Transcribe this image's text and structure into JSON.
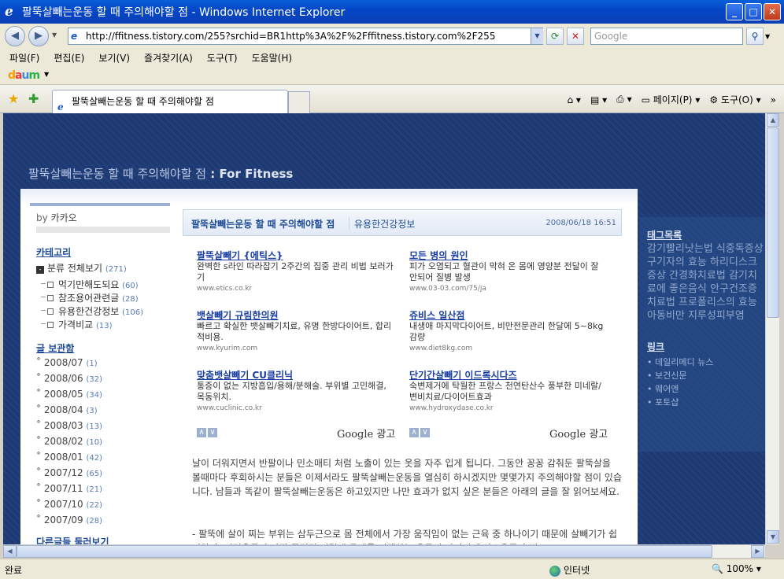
{
  "window": {
    "title": "팔뚝살빼는운동 할 때 주의해야할 점 - Windows Internet Explorer"
  },
  "address": {
    "url": "http://ffitness.tistory.com/255?srchid=BR1http%3A%2F%2Fffitness.tistory.com%2F255",
    "search_placeholder": "Google"
  },
  "menu": [
    "파일(F)",
    "편집(E)",
    "보기(V)",
    "즐겨찾기(A)",
    "도구(T)",
    "도움말(H)"
  ],
  "linkbar": {
    "logo": "daum"
  },
  "tab": {
    "title": "팔뚝살빼는운동 할 때 주의해야할 점"
  },
  "toolbar": {
    "page": "페이지(P)",
    "tools": "도구(O)"
  },
  "blog": {
    "title": "팔뚝살빼는운동 할 때 주의해야할 점",
    "suffix": " : For Fitness"
  },
  "left": {
    "by_prefix": "by ",
    "by_name": "카카오",
    "cat_heading": "카테고리",
    "cat_all": "분류 전체보기",
    "cat_all_count": "(271)",
    "cats": [
      {
        "label": "먹기만해도되요",
        "count": "(60)"
      },
      {
        "label": "참조용어관련글",
        "count": "(28)"
      },
      {
        "label": "유용한건강정보",
        "count": "(106)"
      },
      {
        "label": "가격비교",
        "count": "(13)"
      }
    ],
    "archive_heading": "글 보관함",
    "archives": [
      {
        "label": "2008/07",
        "count": "(1)"
      },
      {
        "label": "2008/06",
        "count": "(32)"
      },
      {
        "label": "2008/05",
        "count": "(34)"
      },
      {
        "label": "2008/04",
        "count": "(3)"
      },
      {
        "label": "2008/03",
        "count": "(13)"
      },
      {
        "label": "2008/02",
        "count": "(10)"
      },
      {
        "label": "2008/01",
        "count": "(42)"
      },
      {
        "label": "2007/12",
        "count": "(65)"
      },
      {
        "label": "2007/11",
        "count": "(21)"
      },
      {
        "label": "2007/10",
        "count": "(22)"
      },
      {
        "label": "2007/09",
        "count": "(28)"
      }
    ],
    "more_heading": "다른글들 둘러보기"
  },
  "post": {
    "title": "팔뚝살빼는운동 할 때 주의해야할 점",
    "category": "유용한건강정보",
    "date": "2008/06/18 16:51",
    "ads": [
      {
        "title": "팔뚝살빼기 {에틱스}",
        "desc": "완벽한 s라인 따라잡기 2주간의 집중 관리 비법 보러가기",
        "url": "www.etics.co.kr"
      },
      {
        "title": "모든 병의 원인",
        "desc": "피가 오염되고 혈관이 막혀 온 몸에 영양분 전달이 잘 안되어 질병 발생",
        "url": "www.03-03.com/75/ja"
      },
      {
        "title": "뱃살빼기 규림한의원",
        "desc": "빠르고 확실한 뱃살빼기치료, 유명 한방다이어트, 합리적비용.",
        "url": "www.kyurim.com"
      },
      {
        "title": "쥬비스 일산점",
        "desc": "내생애 마지막다이어트, 비만전문관리 한달에 5~8kg 감량",
        "url": "www.diet8kg.com"
      },
      {
        "title": "맞춤뱃살빼기 CU클리닉",
        "desc": "통증이 없는 지방흡입/용해/분해술. 부위별 고민해결, 목동위치.",
        "url": "www.cuclinic.co.kr"
      },
      {
        "title": "단기간살빼기 이드록시다즈",
        "desc": "숙변제거에 탁월한 프랑스 천연탄산수 풍부한 미네랄/변비치료/다이어트효과",
        "url": "www.hydroxydase.co.kr"
      }
    ],
    "google_ad": "Google 광고",
    "ad_nav_prev": "∧",
    "ad_nav_next": "∨",
    "para1": "날이 더워지면서 반팔이나 민소매티 처럼 노출이 있는 옷을 자주 입게 됩니다. 그동안 꽁꽁 감춰둔 팔뚝살을 볼때마다 후회하시는 분들은 이제서라도 팔뚝살빼는운동을 열심히 하시겠지만 몇몇가지 주의해야할 점이 있습니다. 남들과 똑같이 팔뚝살빼는운동은 하고있지만 나만 효과가 없지 싶은 분들은 아래의 글을 잘 읽어보세요.",
    "para2": "- 팔뚝에 살이 찌는 부위는 삼두근으로 몸 전체에서 가장 움직임이 없는 근육 중 하나이기 때문에 살빼기가 쉽지않다. 이런운동이 가장 중점적 이렇게 무게를 지탱하는 운동이 아니기 유산소운동과 병"
  },
  "right": {
    "tag_heading": "태그목록",
    "tags": "감기빨리낫는법 식중독증상 구기자의 효능 하리디스크증상 간경화치료법 감기치료에 좋은음식 안구건조증치료법 프로폴리스의 효능 아동비만 지루성피부염",
    "link_heading": "링크",
    "links": [
      "데일리메디 뉴스",
      "보건신문",
      "웨어엔",
      "포토샵"
    ]
  },
  "status": {
    "text": "완료",
    "zone": "인터넷",
    "zoom": "100%"
  }
}
